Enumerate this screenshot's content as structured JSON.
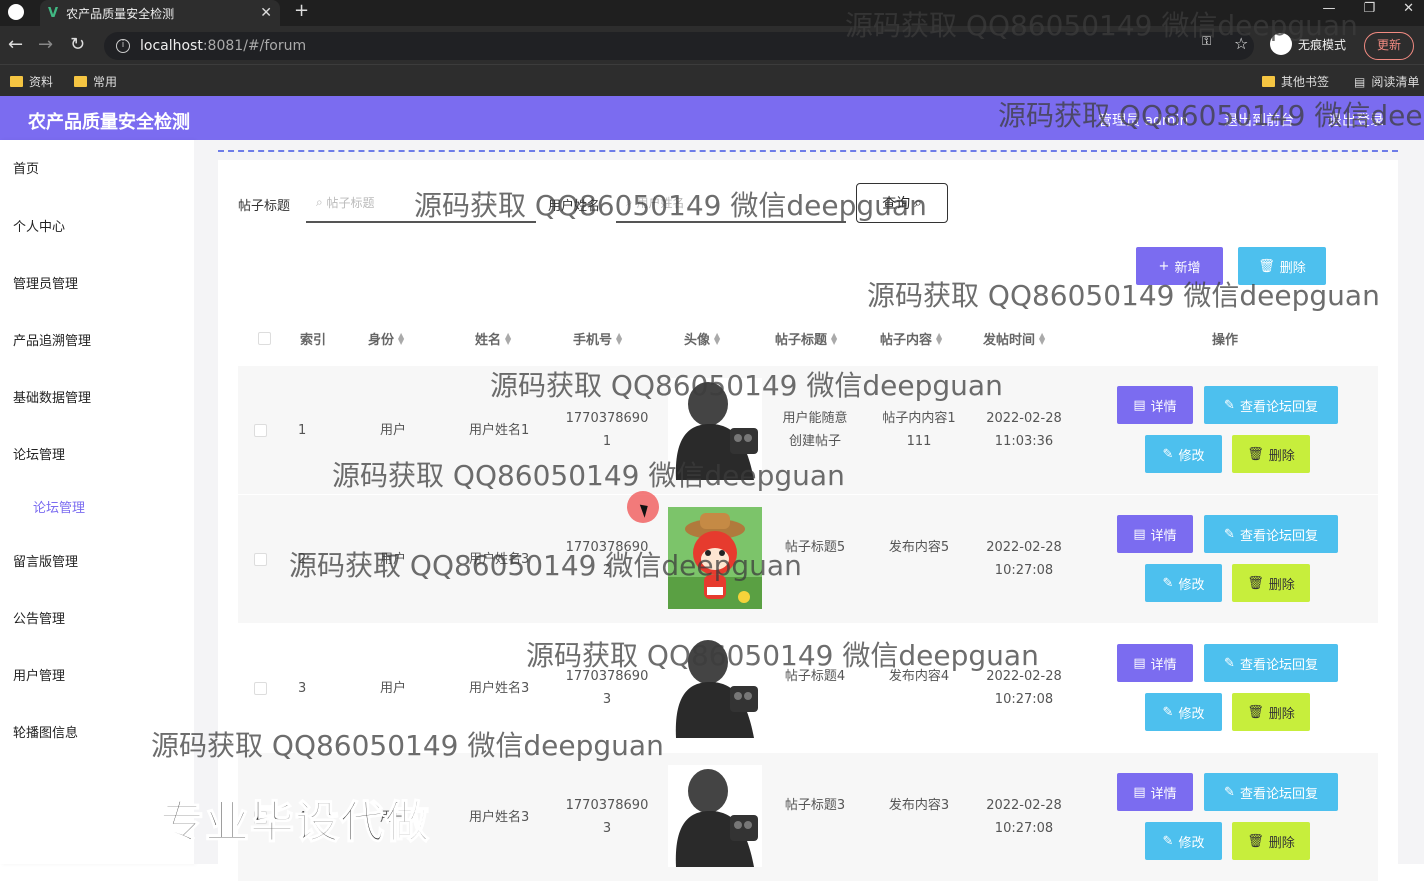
{
  "browser": {
    "tab_title": "农产品质量安全检测",
    "url_host": "localhost",
    "url_rest": ":8081/#/forum",
    "incognito_label": "无痕模式",
    "update_label": "更新",
    "bookmarks": [
      "资料",
      "常用"
    ],
    "bookmarks_right": [
      "其他书签",
      "阅读清单"
    ]
  },
  "app": {
    "title": "农产品质量安全检测",
    "header_links": [
      "管理员 admin",
      "退出到前台",
      "退出登录"
    ],
    "accent": "#7b6cf0"
  },
  "sidebar": {
    "items": [
      {
        "label": "首页"
      },
      {
        "label": "个人中心"
      },
      {
        "label": "管理员管理"
      },
      {
        "label": "产品追溯管理"
      },
      {
        "label": "基础数据管理"
      },
      {
        "label": "论坛管理"
      },
      {
        "label": "论坛管理"
      },
      {
        "label": "留言版管理"
      },
      {
        "label": "公告管理"
      },
      {
        "label": "用户管理"
      },
      {
        "label": "轮播图信息"
      }
    ]
  },
  "search": {
    "title_label": "帖子标题",
    "title_placeholder": "帖子标题",
    "name_label": "用户姓名",
    "name_placeholder": "用户姓名",
    "query_label": "查询"
  },
  "actions": {
    "add": "新增",
    "delete": "删除"
  },
  "table": {
    "headers": [
      "索引",
      "身份",
      "姓名",
      "手机号",
      "头像",
      "帖子标题",
      "帖子内容",
      "发帖时间",
      "操作"
    ],
    "row_buttons": {
      "detail": "详情",
      "replies": "查看论坛回复",
      "edit": "修改",
      "delete": "删除"
    },
    "rows": [
      {
        "index": "1",
        "role": "用户",
        "name": "用户姓名1",
        "phone1": "1770378690",
        "phone2": "1",
        "title1": "用户能随意",
        "title2": "创建帖子",
        "content1": "帖子内内容1",
        "content2": "111",
        "date": "2022-02-28",
        "time": "11:03:36",
        "avatar": "silhouette"
      },
      {
        "index": "2",
        "role": "用户",
        "name": "用户姓名3",
        "phone1": "1770378690",
        "phone2": "2",
        "title1": "帖子标题5",
        "title2": "",
        "content1": "发布内容5",
        "content2": "",
        "date": "2022-02-28",
        "time": "10:27:08",
        "avatar": "cartoon"
      },
      {
        "index": "3",
        "role": "用户",
        "name": "用户姓名3",
        "phone1": "1770378690",
        "phone2": "3",
        "title1": "帖子标题4",
        "title2": "",
        "content1": "发布内容4",
        "content2": "",
        "date": "2022-02-28",
        "time": "10:27:08",
        "avatar": "silhouette"
      },
      {
        "index": "4",
        "role": "用户",
        "name": "用户姓名3",
        "phone1": "1770378690",
        "phone2": "3",
        "title1": "帖子标题3",
        "title2": "",
        "content1": "发布内容3",
        "content2": "",
        "date": "2022-02-28",
        "time": "10:27:08",
        "avatar": "silhouette"
      }
    ]
  },
  "watermark": {
    "text": "源码获取 QQ86050149 微信deepguan",
    "big": "专业毕设代做"
  }
}
